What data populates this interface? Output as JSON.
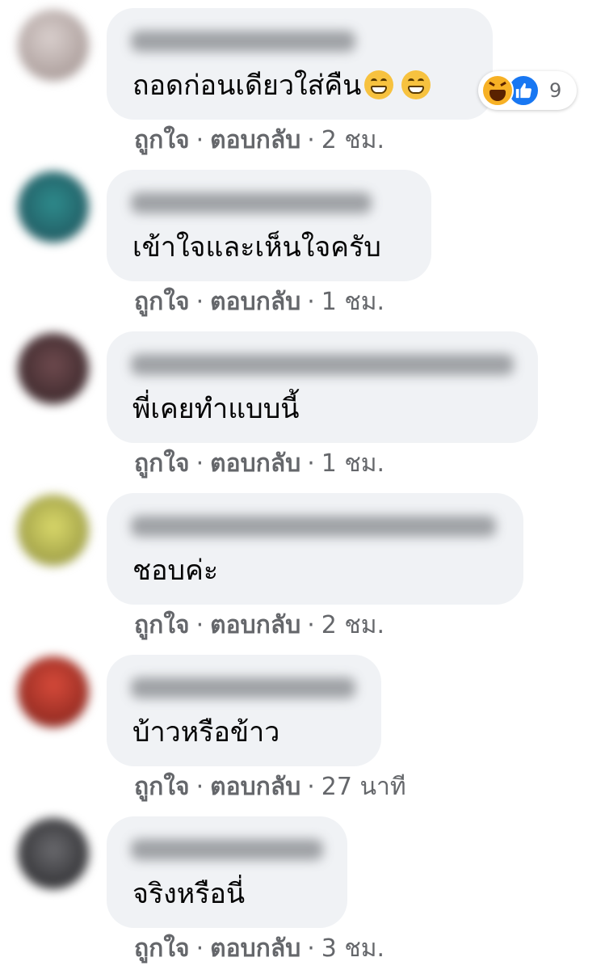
{
  "comments": [
    {
      "text": "ถอดก่อนเดียวใส่คืน",
      "emoji": [
        "grinning-face-emoji",
        "grinning-face-emoji"
      ],
      "avatar_color": "#b7a9a6",
      "reactions": {
        "icons": [
          "haha-reaction-icon",
          "like-reaction-icon"
        ],
        "count": "9"
      },
      "like": "ถูกใจ",
      "reply": "ตอบกลับ",
      "sep": "·",
      "time": "2 ชม."
    },
    {
      "text": "เข้าใจและเห็นใจครับ",
      "avatar_color": "#2f6f7c",
      "like": "ถูกใจ",
      "reply": "ตอบกลับ",
      "sep": "·",
      "time": "1 ชม."
    },
    {
      "text": "พี่เคยทำแบบนี้",
      "avatar_color": "#4a2f33",
      "like": "ถูกใจ",
      "reply": "ตอบกลับ",
      "sep": "·",
      "time": "1 ชม."
    },
    {
      "text": "ชอบค่ะ",
      "avatar_color": "#b8b64f",
      "like": "ถูกใจ",
      "reply": "ตอบกลับ",
      "sep": "·",
      "time": "2 ชม."
    },
    {
      "text": "บ้าวหรือข้าว",
      "avatar_color": "#b2362c",
      "like": "ถูกใจ",
      "reply": "ตอบกลับ",
      "sep": "·",
      "time": "27 นาที"
    },
    {
      "text": "จริงหรือนี่",
      "avatar_color": "#3b3b3e",
      "like": "ถูกใจ",
      "reply": "ตอบกลับ",
      "sep": "·",
      "time": "3 ชม."
    }
  ],
  "colors": {
    "bubble": "#f0f2f5",
    "meta_text": "#65676b",
    "body_text": "#050505",
    "like_blue": "#1877f2"
  }
}
